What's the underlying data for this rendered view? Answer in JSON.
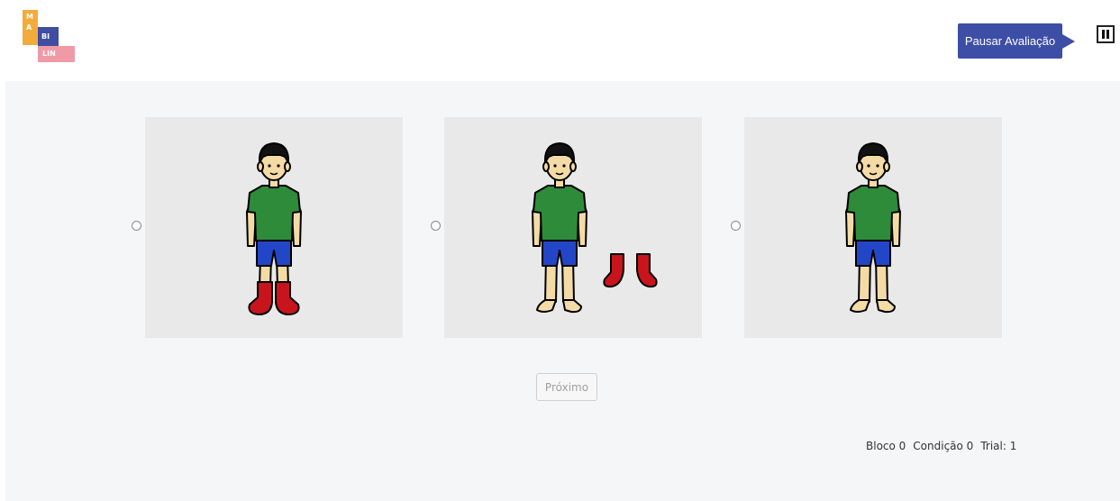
{
  "logo": {
    "line1": "M",
    "line2": "A",
    "bi": "BI",
    "lin": "LIN"
  },
  "header": {
    "pause_label": "Pausar Avaliação",
    "pause_icon": "pause-icon"
  },
  "options": [
    {
      "id": "option-1",
      "feet": "red-boots-on",
      "icon": "boy-with-red-boots"
    },
    {
      "id": "option-2",
      "feet": "barefoot-boots-beside",
      "icon": "boy-barefoot-with-boots-beside"
    },
    {
      "id": "option-3",
      "feet": "barefoot",
      "icon": "boy-barefoot"
    }
  ],
  "footer": {
    "next_label": "Próximo",
    "bloco": "Bloco 0",
    "condicao": "Condição 0",
    "trial": "Trial: 1"
  },
  "colors": {
    "accent": "#3d4ea6",
    "logo_orange": "#f3ac3c",
    "logo_blue": "#3f4da2",
    "logo_pink": "#ef9aa6",
    "shirt": "#2e8b3a",
    "shorts": "#2346c8",
    "boots": "#c8141c"
  }
}
